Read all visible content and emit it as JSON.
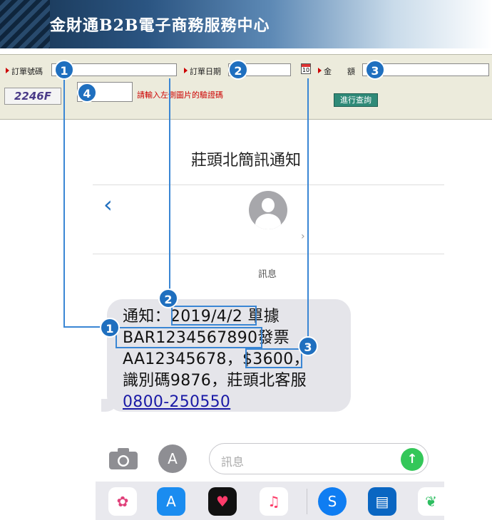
{
  "banner": {
    "title": "金財通B2B電子商務服務中心"
  },
  "form": {
    "order_no_label": "訂單號碼",
    "order_date_label": "訂單日期",
    "amount_label": "金　　額",
    "calendar_day": "10",
    "captcha": "2246F",
    "captcha_hint": "請輸入左側圖片的驗證碼",
    "query_button": "進行查詢"
  },
  "badges": {
    "b1": "1",
    "b2": "2",
    "b3": "3",
    "b4": "4"
  },
  "sms": {
    "page_title": "莊頭北簡訊通知",
    "contact_label": "訊息",
    "t_notice": "通知：",
    "t_date": "2019/4/2",
    "t_receipt": "單據",
    "t_order": "BAR1234567890",
    "t_invoice": "發票",
    "t_inv_no": "AA12345678，",
    "t_amount": "$3600",
    "t_comma": "，",
    "t_line4": "識別碼9876，莊頭北客服",
    "t_phone": "0800-250550",
    "input_placeholder": "訊息"
  },
  "colors": {
    "badge": "#1f6fbf",
    "connector": "#3a86d4",
    "send": "#34c759"
  }
}
